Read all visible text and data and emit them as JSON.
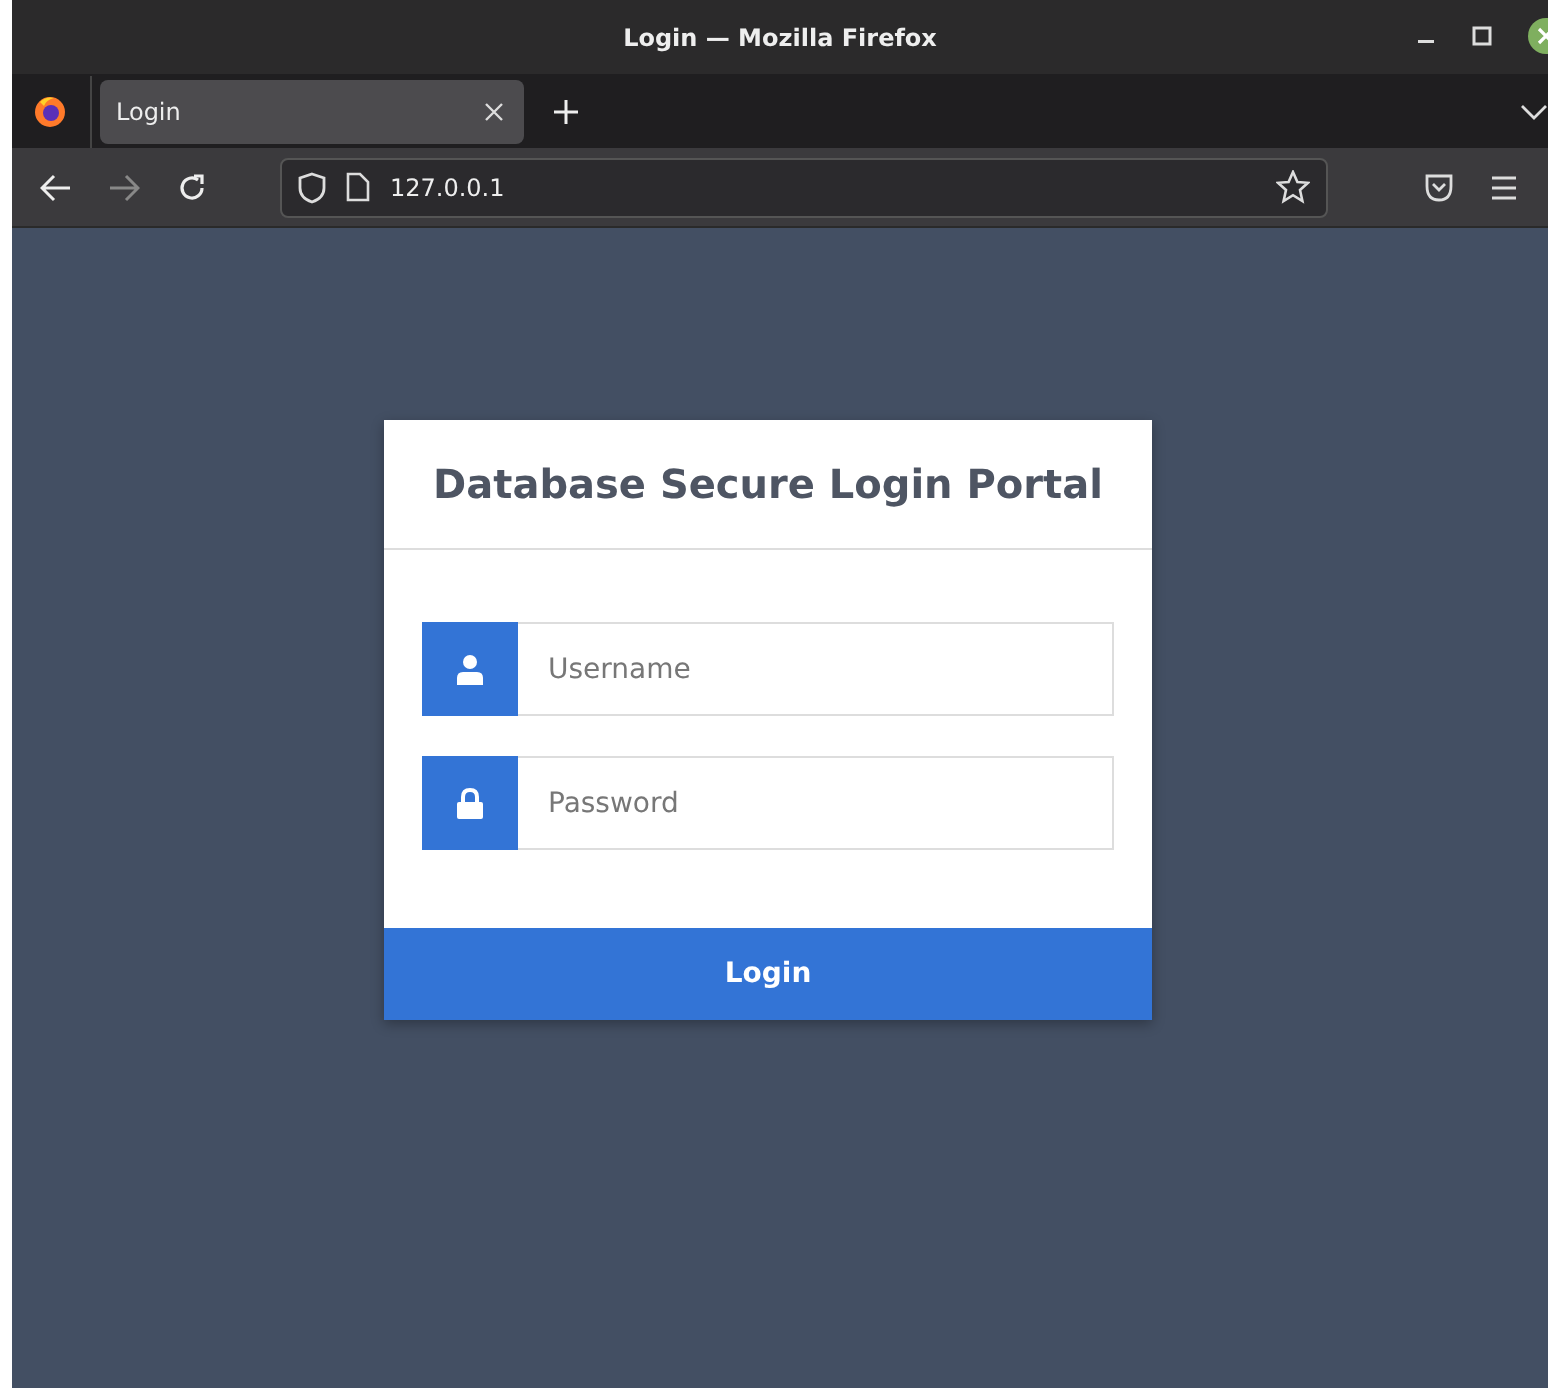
{
  "window": {
    "title": "Login — Mozilla Firefox"
  },
  "tabs": [
    {
      "label": "Login",
      "selected": true
    }
  ],
  "address_bar": {
    "url": "127.0.0.1"
  },
  "login_card": {
    "title": "Database Secure Login Portal",
    "fields": [
      {
        "kind": "user",
        "placeholder": "Username"
      },
      {
        "kind": "password",
        "placeholder": "Password"
      }
    ],
    "button": "Login"
  }
}
